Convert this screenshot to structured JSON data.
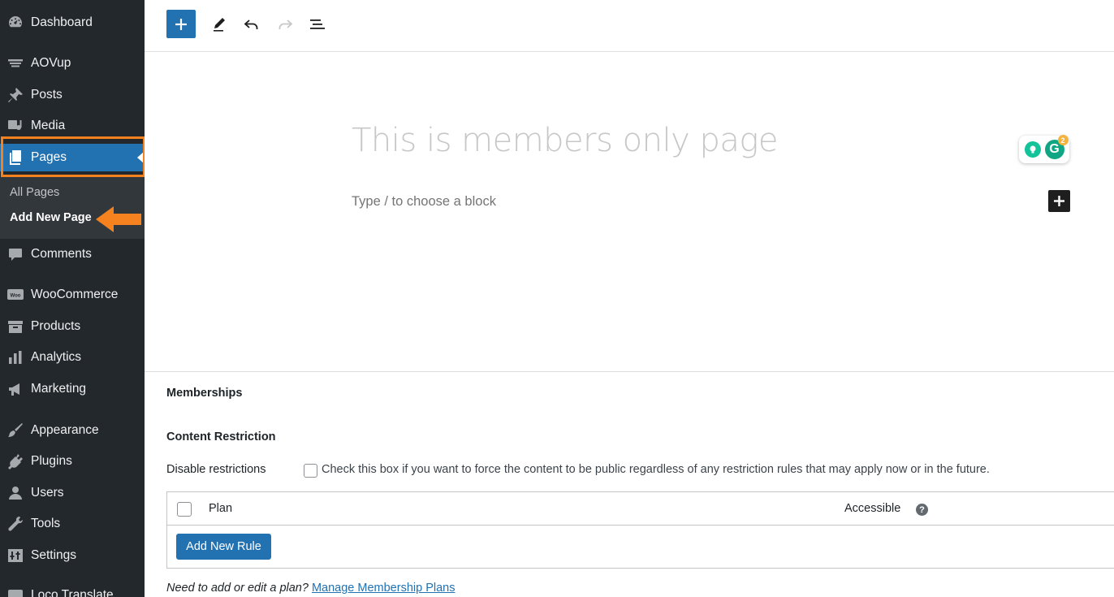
{
  "sidebar": {
    "items": [
      {
        "label": "Dashboard",
        "icon": "dashboard-icon"
      },
      {
        "label": "AOVup",
        "icon": "aovup-icon"
      },
      {
        "label": "Posts",
        "icon": "pin-icon"
      },
      {
        "label": "Media",
        "icon": "media-icon"
      },
      {
        "label": "Pages",
        "icon": "pages-icon"
      },
      {
        "label": "Comments",
        "icon": "comment-icon"
      },
      {
        "label": "WooCommerce",
        "icon": "woocommerce-icon"
      },
      {
        "label": "Products",
        "icon": "products-icon"
      },
      {
        "label": "Analytics",
        "icon": "analytics-icon"
      },
      {
        "label": "Marketing",
        "icon": "megaphone-icon"
      },
      {
        "label": "Appearance",
        "icon": "brush-icon"
      },
      {
        "label": "Plugins",
        "icon": "plugin-icon"
      },
      {
        "label": "Users",
        "icon": "users-icon"
      },
      {
        "label": "Tools",
        "icon": "wrench-icon"
      },
      {
        "label": "Settings",
        "icon": "settings-icon"
      },
      {
        "label": "Loco Translate",
        "icon": "translate-icon"
      }
    ],
    "submenu": {
      "all_pages": "All Pages",
      "add_new_page": "Add New Page"
    },
    "accent_color": "#2271b1",
    "highlight_color": "#f6821f"
  },
  "toolbar": {
    "buttons": [
      "add-block-icon",
      "pencil-icon",
      "undo-icon",
      "redo-icon",
      "list-view-icon"
    ]
  },
  "editor": {
    "title_placeholder": "This is members only page",
    "block_placeholder": "Type / to choose a block",
    "grammarly_count": "2"
  },
  "memberships": {
    "title": "Memberships",
    "content_restriction": "Content Restriction",
    "disable_label": "Disable restrictions",
    "disable_desc": "Check this box if you want to force the content to be public regardless of any restriction rules that may apply now or in the future.",
    "table": {
      "col_plan": "Plan",
      "col_accessible": "Accessible",
      "add_rule": "Add New Rule"
    },
    "footer_text": "Need to add or edit a plan?",
    "footer_link": "Manage Membership Plans"
  }
}
